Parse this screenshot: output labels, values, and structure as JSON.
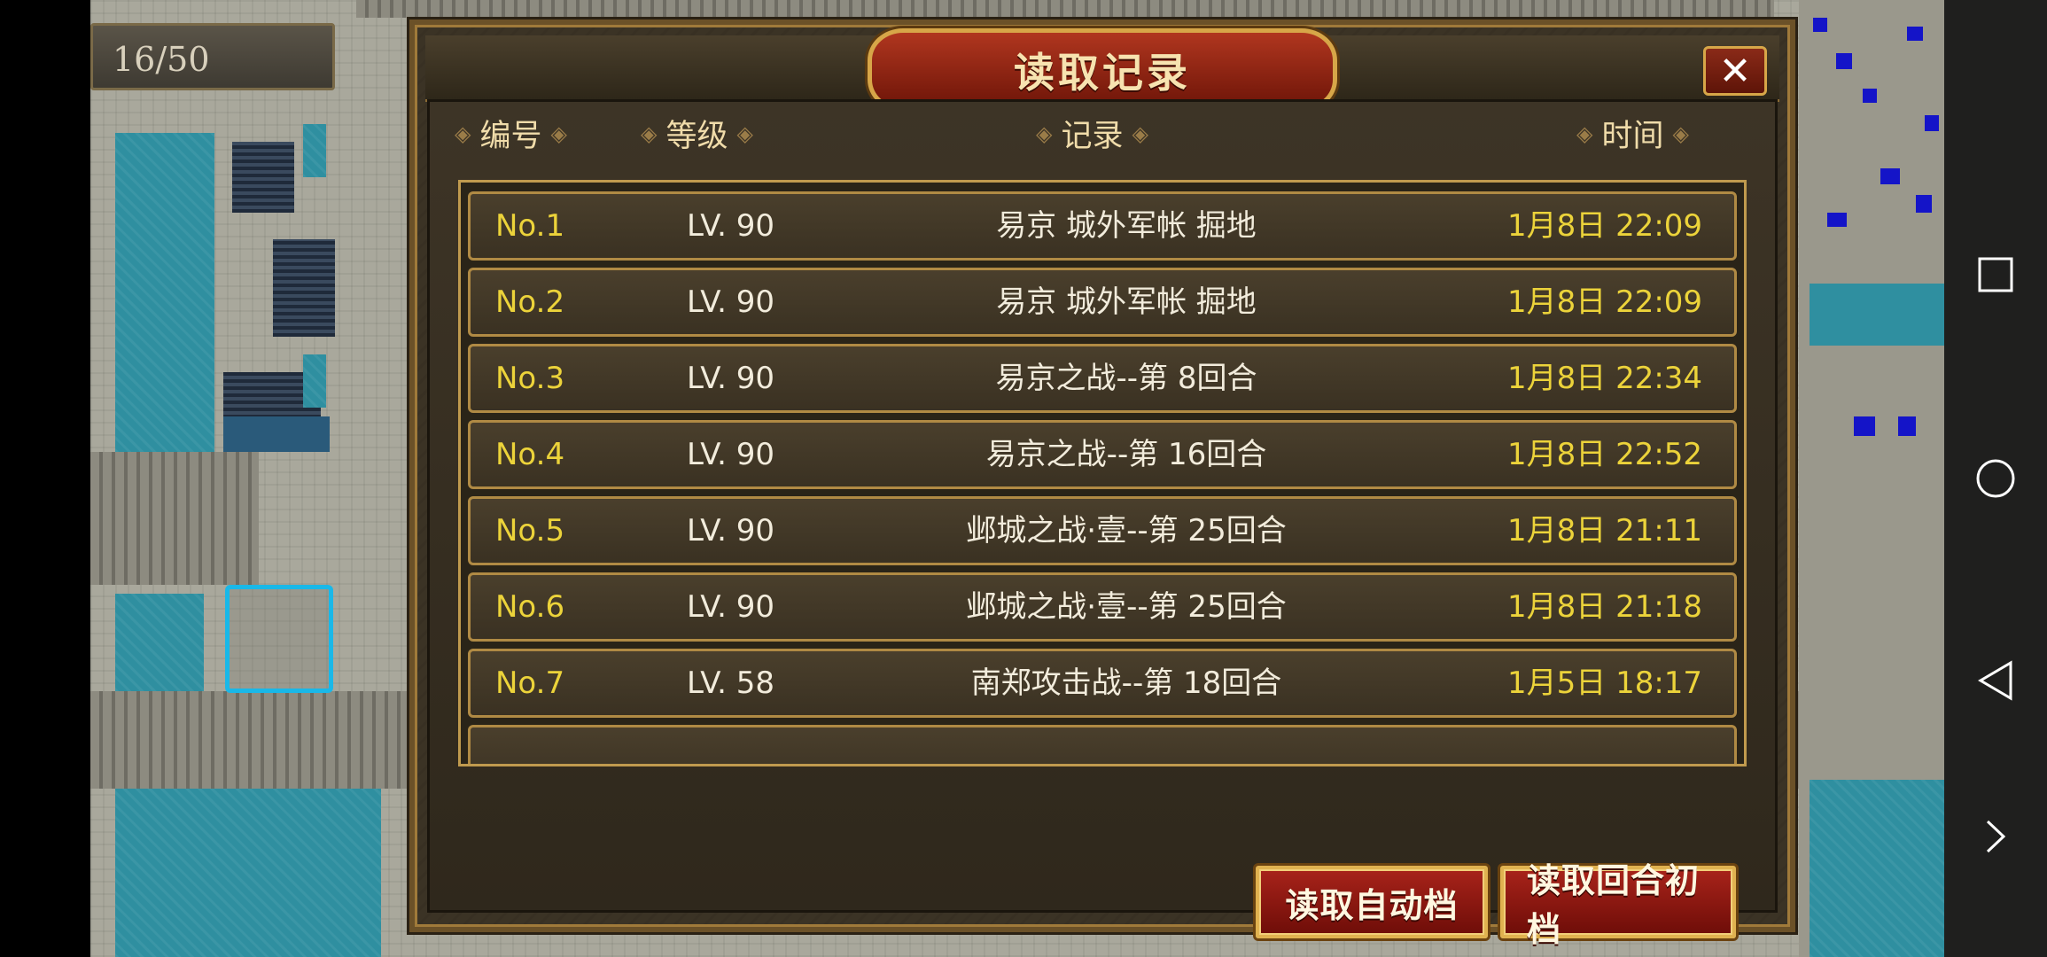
{
  "hud": {
    "counter": "16/50"
  },
  "dialog": {
    "title": "读取记录",
    "close_label": "✕",
    "columns": {
      "no": "编号",
      "level": "等级",
      "record": "记录",
      "time": "时间"
    },
    "records": [
      {
        "no": "No.1",
        "level": "LV. 90",
        "record": "易京  城外军帐 掘地",
        "time": "1月8日 22:09"
      },
      {
        "no": "No.2",
        "level": "LV. 90",
        "record": "易京  城外军帐 掘地",
        "time": "1月8日 22:09"
      },
      {
        "no": "No.3",
        "level": "LV. 90",
        "record": "易京之战--第 8回合",
        "time": "1月8日 22:34"
      },
      {
        "no": "No.4",
        "level": "LV. 90",
        "record": "易京之战--第 16回合",
        "time": "1月8日 22:52"
      },
      {
        "no": "No.5",
        "level": "LV. 90",
        "record": "邺城之战·壹--第 25回合",
        "time": "1月8日 21:11"
      },
      {
        "no": "No.6",
        "level": "LV. 90",
        "record": "邺城之战·壹--第 25回合",
        "time": "1月8日 21:18"
      },
      {
        "no": "No.7",
        "level": "LV. 58",
        "record": "南郑攻击战--第 18回合",
        "time": "1月5日 18:17"
      }
    ],
    "buttons": {
      "load_auto": "读取自动档",
      "load_turn_start": "读取回合初档"
    }
  },
  "navbar": {
    "icons": [
      "square-icon",
      "circle-icon",
      "triangle-back-icon",
      "chevron-right-icon"
    ]
  },
  "colors": {
    "accent_gold": "#d7a648",
    "title_red": "#b0361f",
    "record_number_yellow": "#ecd33a"
  }
}
